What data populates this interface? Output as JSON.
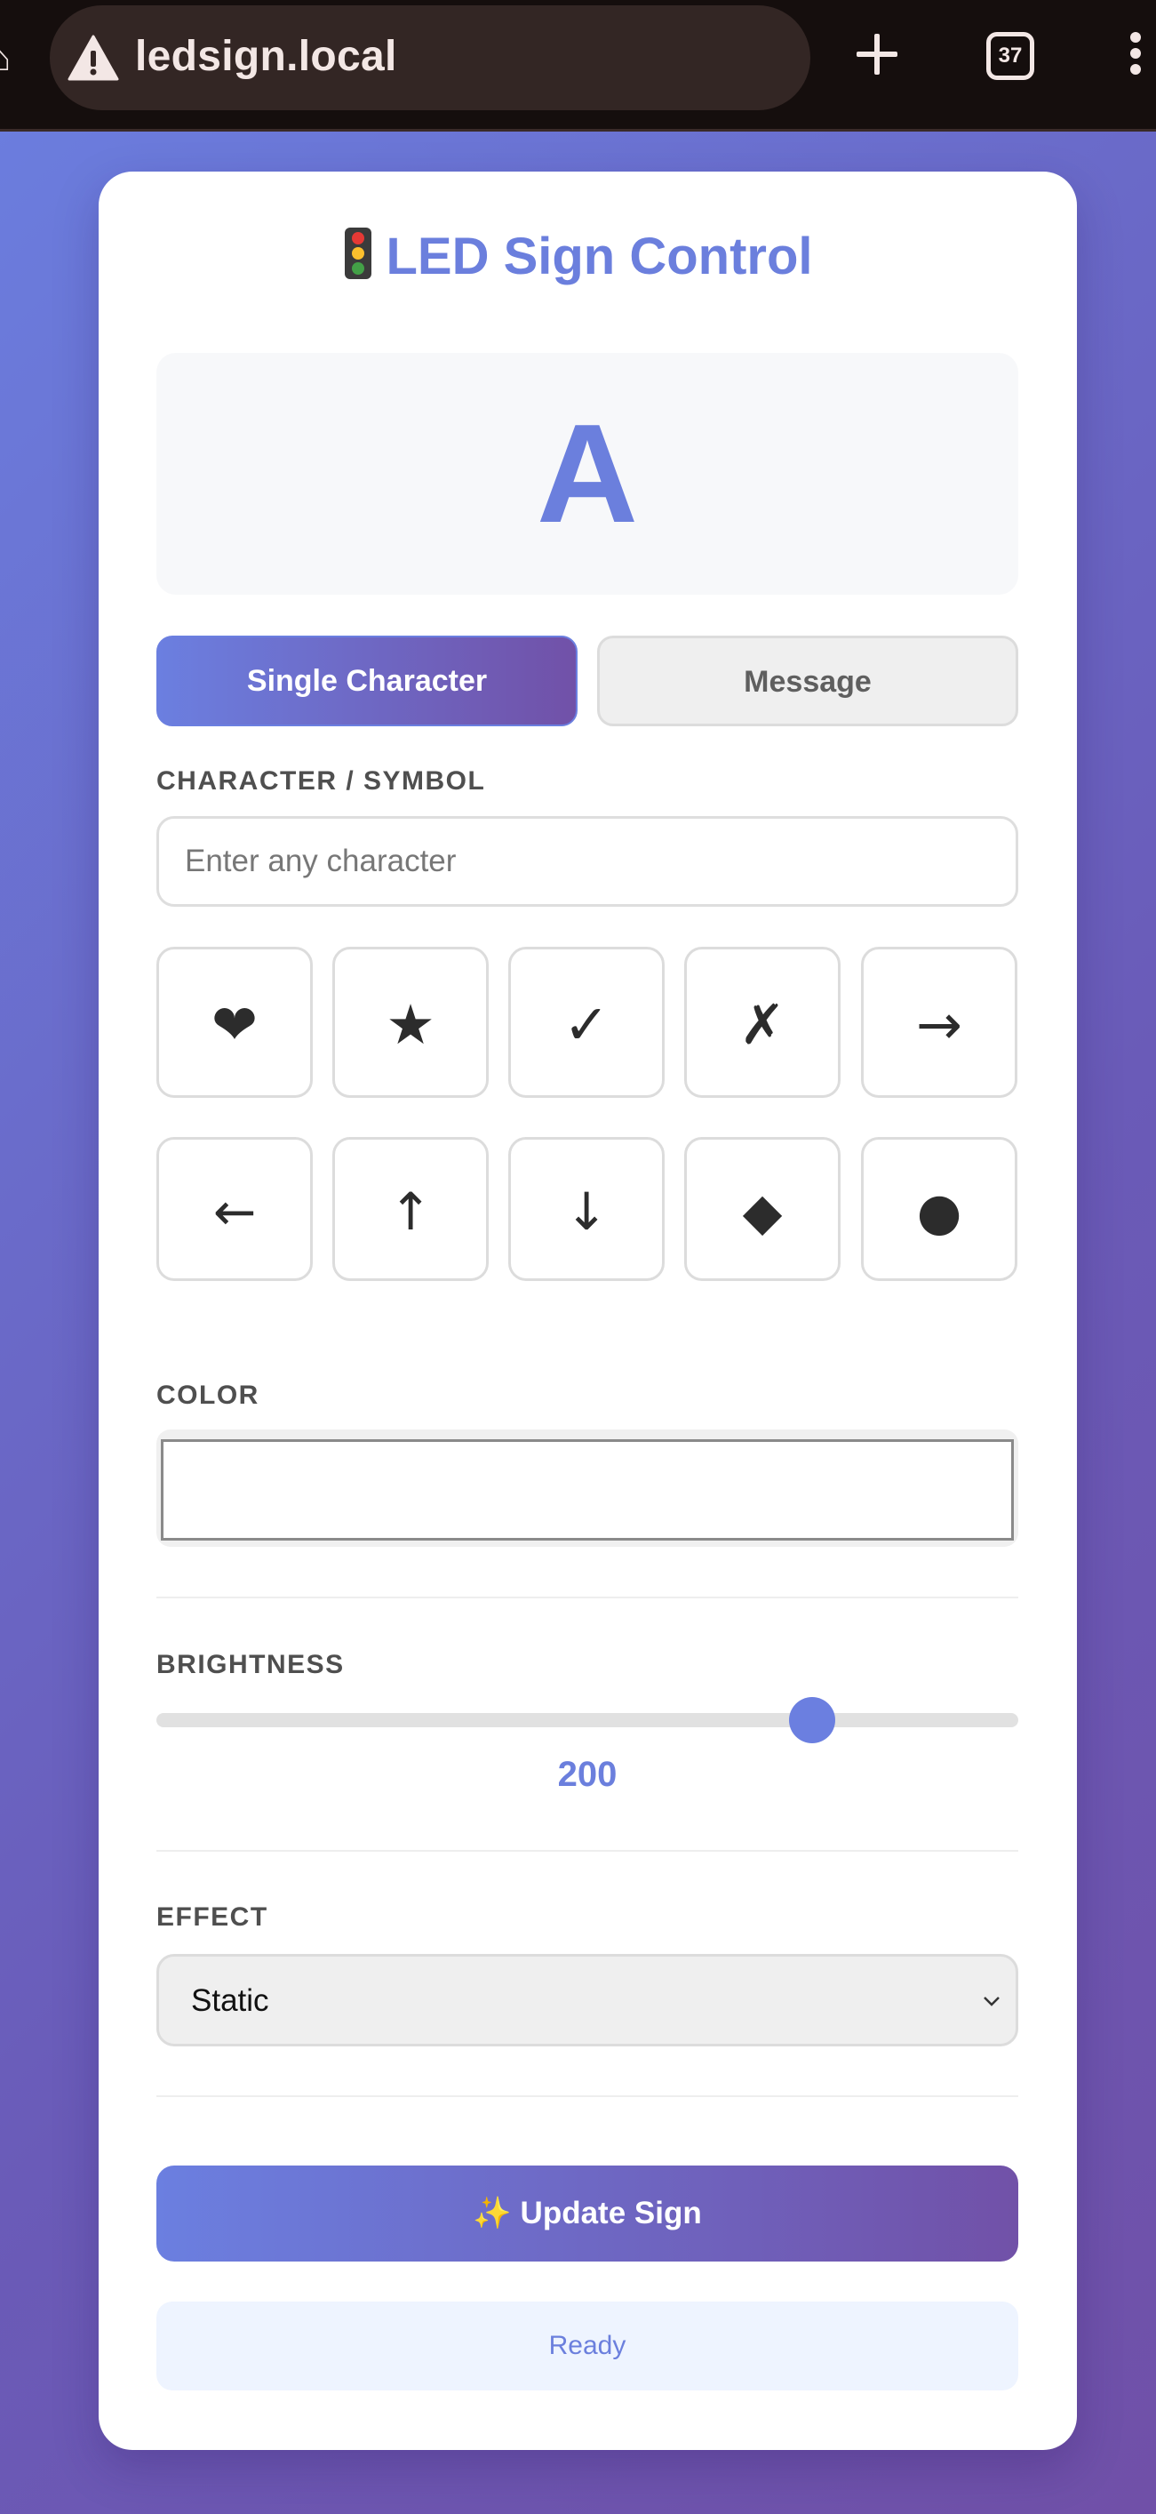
{
  "browser": {
    "url": "ledsign.local",
    "tab_count": "37",
    "icons": [
      "home-icon",
      "warning-icon",
      "plus-icon",
      "tabs-icon",
      "menu-icon"
    ]
  },
  "app": {
    "title": "LED Sign Control",
    "title_icon": "traffic-light-icon",
    "accent_color": "#6b7fdd",
    "gradient_end_color": "#7151a8"
  },
  "preview": {
    "character": "A"
  },
  "modes": [
    {
      "label": "Single Character",
      "active": true
    },
    {
      "label": "Message",
      "active": false
    }
  ],
  "character": {
    "label": "CHARACTER / SYMBOL",
    "value": "",
    "placeholder": "Enter any character"
  },
  "symbols": [
    "❤",
    "★",
    "✓",
    "✗",
    "→",
    "←",
    "↑",
    "↓",
    "◆",
    "●"
  ],
  "color": {
    "label": "COLOR",
    "value": "#ffffff"
  },
  "brightness": {
    "label": "BRIGHTNESS",
    "value": "200",
    "max": 255
  },
  "effect": {
    "label": "EFFECT",
    "selected": "Static"
  },
  "actions": {
    "update_label": "✨ Update Sign"
  },
  "status": {
    "text": "Ready"
  }
}
